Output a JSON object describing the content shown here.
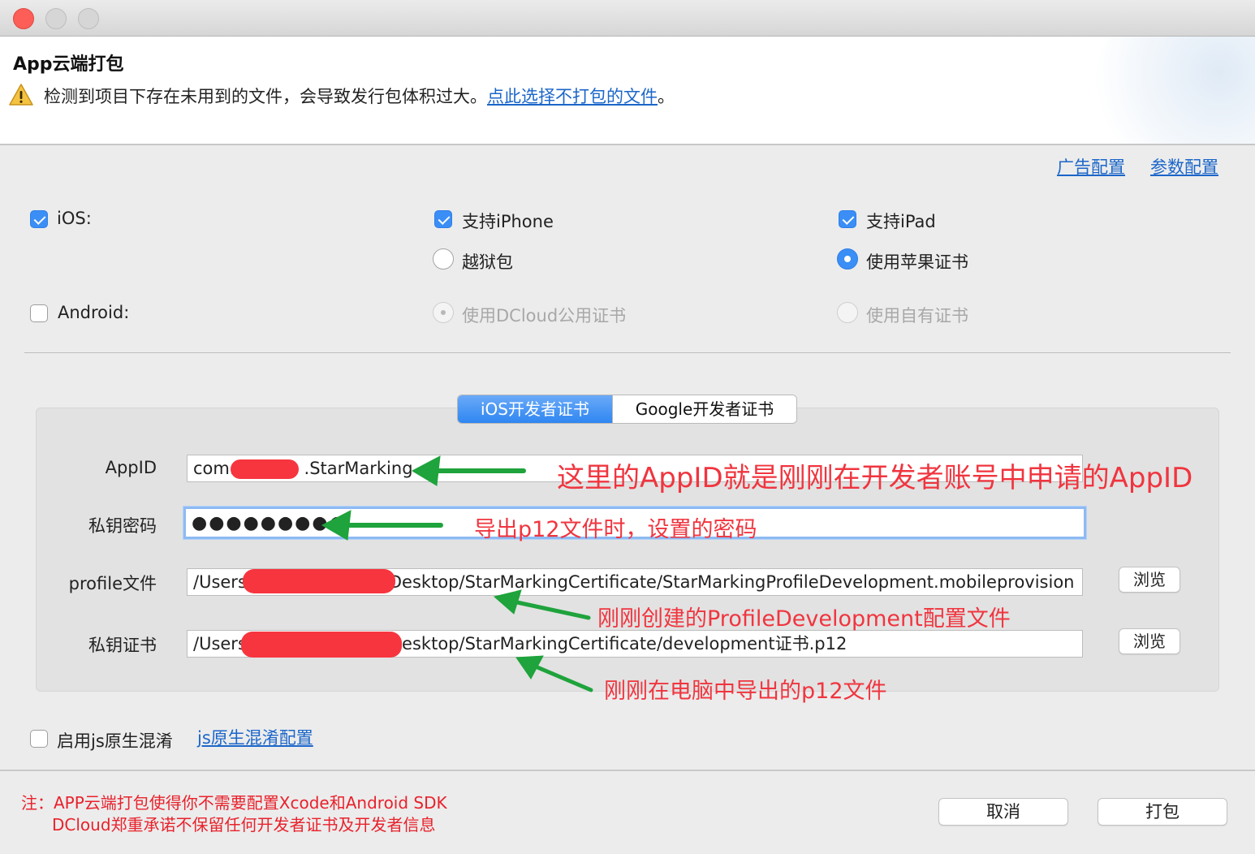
{
  "dialog": {
    "title": "App云端打包",
    "warning_text": "检测到项目下存在未用到的文件，会导致发行包体积过大。",
    "warning_link": "点此选择不打包的文件",
    "warning_suffix": "。"
  },
  "top_links": {
    "ad_config": "广告配置",
    "param_config": "参数配置"
  },
  "platforms": {
    "ios": {
      "label": "iOS:",
      "checked": true
    },
    "support_iphone": {
      "label": "支持iPhone",
      "checked": true
    },
    "support_ipad": {
      "label": "支持iPad",
      "checked": true
    },
    "jailbreak": {
      "label": "越狱包",
      "selected": false
    },
    "apple_cert": {
      "label": "使用苹果证书",
      "selected": true
    },
    "android": {
      "label": "Android:",
      "checked": false
    },
    "dcloud_cert": {
      "label": "使用DCloud公用证书",
      "selected": true,
      "disabled": true
    },
    "own_cert": {
      "label": "使用自有证书",
      "selected": false,
      "disabled": true
    }
  },
  "tabs": {
    "ios_cert": "iOS开发者证书",
    "google_cert": "Google开发者证书",
    "active": "ios_cert"
  },
  "form": {
    "appid_label": "AppID",
    "appid_prefix": "com.",
    "appid_suffix": ".StarMarking",
    "password_label": "私钥密码",
    "password_value": "●●●●●●●●●",
    "profile_label": "profile文件",
    "profile_prefix": "/Users",
    "profile_suffix": "Desktop/StarMarkingCertificate/StarMarkingProfileDevelopment.mobileprovision",
    "cert_label": "私钥证书",
    "cert_prefix": "/Users",
    "cert_suffix": "Desktop/StarMarkingCertificate/development证书.p12",
    "browse_label": "浏览"
  },
  "annotations": {
    "appid": "这里的AppID就是刚刚在开发者账号中申请的AppID",
    "password": "导出p12文件时，设置的密码",
    "profile": "刚刚创建的ProfileDevelopment配置文件",
    "cert": "刚刚在电脑中导出的p12文件"
  },
  "obfuscation": {
    "label": "启用js原生混淆",
    "checked": false,
    "config_link": "js原生混淆配置"
  },
  "notes": {
    "line1": "注：APP云端打包使得你不需要配置Xcode和Android SDK",
    "line2": "DCloud郑重承诺不保留任何开发者证书及开发者信息"
  },
  "buttons": {
    "cancel": "取消",
    "pack": "打包"
  },
  "colors": {
    "accent": "#3a8ef6",
    "link": "#1b66c9",
    "annotation": "#f0353f",
    "arrow": "#1fa33c",
    "note": "#e8222c"
  }
}
